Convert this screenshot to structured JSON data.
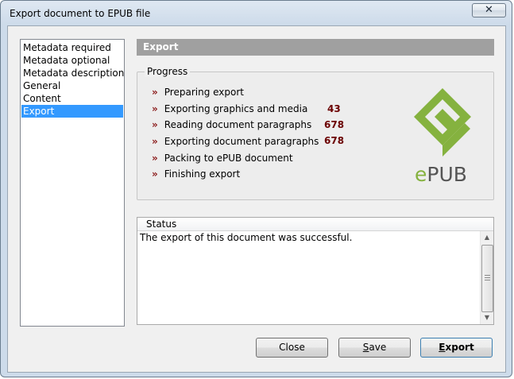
{
  "window": {
    "title": "Export document to EPUB file",
    "close_glyph": "✕"
  },
  "nav": {
    "items": [
      {
        "label": "Metadata required"
      },
      {
        "label": "Metadata optional"
      },
      {
        "label": "Metadata description"
      },
      {
        "label": "General"
      },
      {
        "label": "Content"
      },
      {
        "label": "Export"
      }
    ],
    "selected_index": 5
  },
  "page": {
    "header": "Export"
  },
  "progress": {
    "title": "Progress",
    "bullet": "»",
    "steps": [
      {
        "label": "Preparing export",
        "count": ""
      },
      {
        "label": "Exporting graphics and media",
        "count": "43"
      },
      {
        "label": "Reading document paragraphs",
        "count": "678"
      },
      {
        "label": "Exporting document paragraphs",
        "count": "678"
      },
      {
        "label": "Packing to ePUB document",
        "count": ""
      },
      {
        "label": "Finishing export",
        "count": ""
      }
    ]
  },
  "logo": {
    "text_e": "e",
    "text_rest": "PUB",
    "green": "#85b23f",
    "gray": "#555555"
  },
  "status": {
    "title": "Status",
    "message": "The export of this document was successful."
  },
  "buttons": {
    "close": "Close",
    "save_first": "S",
    "save_rest": "ave",
    "export_first": "E",
    "export_rest": "xport"
  },
  "colors": {
    "selection": "#3399ff",
    "count_text": "#6b0000",
    "bullet": "#8b1a1a"
  }
}
